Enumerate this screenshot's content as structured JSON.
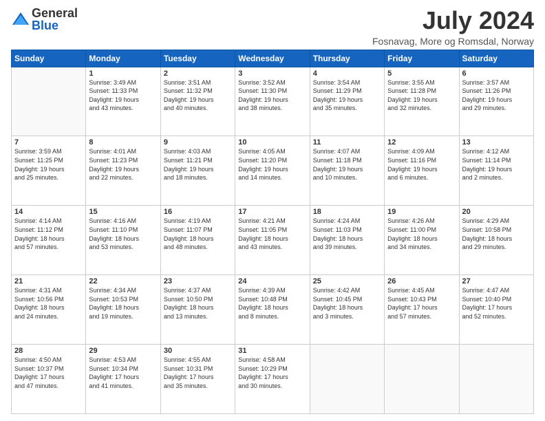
{
  "header": {
    "logo_general": "General",
    "logo_blue": "Blue",
    "month_title": "July 2024",
    "location": "Fosnavag, More og Romsdal, Norway"
  },
  "days_of_week": [
    "Sunday",
    "Monday",
    "Tuesday",
    "Wednesday",
    "Thursday",
    "Friday",
    "Saturday"
  ],
  "weeks": [
    [
      {
        "day": "",
        "info": ""
      },
      {
        "day": "1",
        "info": "Sunrise: 3:49 AM\nSunset: 11:33 PM\nDaylight: 19 hours\nand 43 minutes."
      },
      {
        "day": "2",
        "info": "Sunrise: 3:51 AM\nSunset: 11:32 PM\nDaylight: 19 hours\nand 40 minutes."
      },
      {
        "day": "3",
        "info": "Sunrise: 3:52 AM\nSunset: 11:30 PM\nDaylight: 19 hours\nand 38 minutes."
      },
      {
        "day": "4",
        "info": "Sunrise: 3:54 AM\nSunset: 11:29 PM\nDaylight: 19 hours\nand 35 minutes."
      },
      {
        "day": "5",
        "info": "Sunrise: 3:55 AM\nSunset: 11:28 PM\nDaylight: 19 hours\nand 32 minutes."
      },
      {
        "day": "6",
        "info": "Sunrise: 3:57 AM\nSunset: 11:26 PM\nDaylight: 19 hours\nand 29 minutes."
      }
    ],
    [
      {
        "day": "7",
        "info": "Sunrise: 3:59 AM\nSunset: 11:25 PM\nDaylight: 19 hours\nand 25 minutes."
      },
      {
        "day": "8",
        "info": "Sunrise: 4:01 AM\nSunset: 11:23 PM\nDaylight: 19 hours\nand 22 minutes."
      },
      {
        "day": "9",
        "info": "Sunrise: 4:03 AM\nSunset: 11:21 PM\nDaylight: 19 hours\nand 18 minutes."
      },
      {
        "day": "10",
        "info": "Sunrise: 4:05 AM\nSunset: 11:20 PM\nDaylight: 19 hours\nand 14 minutes."
      },
      {
        "day": "11",
        "info": "Sunrise: 4:07 AM\nSunset: 11:18 PM\nDaylight: 19 hours\nand 10 minutes."
      },
      {
        "day": "12",
        "info": "Sunrise: 4:09 AM\nSunset: 11:16 PM\nDaylight: 19 hours\nand 6 minutes."
      },
      {
        "day": "13",
        "info": "Sunrise: 4:12 AM\nSunset: 11:14 PM\nDaylight: 19 hours\nand 2 minutes."
      }
    ],
    [
      {
        "day": "14",
        "info": "Sunrise: 4:14 AM\nSunset: 11:12 PM\nDaylight: 18 hours\nand 57 minutes."
      },
      {
        "day": "15",
        "info": "Sunrise: 4:16 AM\nSunset: 11:10 PM\nDaylight: 18 hours\nand 53 minutes."
      },
      {
        "day": "16",
        "info": "Sunrise: 4:19 AM\nSunset: 11:07 PM\nDaylight: 18 hours\nand 48 minutes."
      },
      {
        "day": "17",
        "info": "Sunrise: 4:21 AM\nSunset: 11:05 PM\nDaylight: 18 hours\nand 43 minutes."
      },
      {
        "day": "18",
        "info": "Sunrise: 4:24 AM\nSunset: 11:03 PM\nDaylight: 18 hours\nand 39 minutes."
      },
      {
        "day": "19",
        "info": "Sunrise: 4:26 AM\nSunset: 11:00 PM\nDaylight: 18 hours\nand 34 minutes."
      },
      {
        "day": "20",
        "info": "Sunrise: 4:29 AM\nSunset: 10:58 PM\nDaylight: 18 hours\nand 29 minutes."
      }
    ],
    [
      {
        "day": "21",
        "info": "Sunrise: 4:31 AM\nSunset: 10:56 PM\nDaylight: 18 hours\nand 24 minutes."
      },
      {
        "day": "22",
        "info": "Sunrise: 4:34 AM\nSunset: 10:53 PM\nDaylight: 18 hours\nand 19 minutes."
      },
      {
        "day": "23",
        "info": "Sunrise: 4:37 AM\nSunset: 10:50 PM\nDaylight: 18 hours\nand 13 minutes."
      },
      {
        "day": "24",
        "info": "Sunrise: 4:39 AM\nSunset: 10:48 PM\nDaylight: 18 hours\nand 8 minutes."
      },
      {
        "day": "25",
        "info": "Sunrise: 4:42 AM\nSunset: 10:45 PM\nDaylight: 18 hours\nand 3 minutes."
      },
      {
        "day": "26",
        "info": "Sunrise: 4:45 AM\nSunset: 10:43 PM\nDaylight: 17 hours\nand 57 minutes."
      },
      {
        "day": "27",
        "info": "Sunrise: 4:47 AM\nSunset: 10:40 PM\nDaylight: 17 hours\nand 52 minutes."
      }
    ],
    [
      {
        "day": "28",
        "info": "Sunrise: 4:50 AM\nSunset: 10:37 PM\nDaylight: 17 hours\nand 47 minutes."
      },
      {
        "day": "29",
        "info": "Sunrise: 4:53 AM\nSunset: 10:34 PM\nDaylight: 17 hours\nand 41 minutes."
      },
      {
        "day": "30",
        "info": "Sunrise: 4:55 AM\nSunset: 10:31 PM\nDaylight: 17 hours\nand 35 minutes."
      },
      {
        "day": "31",
        "info": "Sunrise: 4:58 AM\nSunset: 10:29 PM\nDaylight: 17 hours\nand 30 minutes."
      },
      {
        "day": "",
        "info": ""
      },
      {
        "day": "",
        "info": ""
      },
      {
        "day": "",
        "info": ""
      }
    ]
  ]
}
